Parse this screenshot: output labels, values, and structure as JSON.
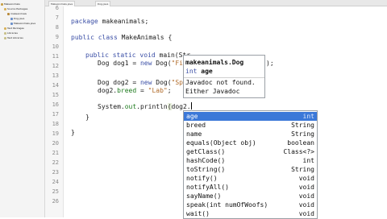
{
  "project_tree": {
    "items": [
      {
        "label": "MakeAnimals",
        "depth": 0
      },
      {
        "label": "Source Packages",
        "depth": 1
      },
      {
        "label": "makeanimals",
        "depth": 2
      },
      {
        "label": "Dog.java",
        "depth": 3
      },
      {
        "label": "MakeAnimals.java",
        "depth": 3
      },
      {
        "label": "Test Packages",
        "depth": 1
      },
      {
        "label": "Libraries",
        "depth": 1
      },
      {
        "label": "Test Libraries",
        "depth": 1
      }
    ]
  },
  "editor": {
    "tabs": [
      {
        "label": "MakeAnimals.java"
      },
      {
        "label": "Dog.java"
      }
    ],
    "line_numbers": [
      "6",
      "7",
      "8",
      "9",
      "10",
      "11",
      "12",
      "13",
      "14",
      "15",
      "16",
      "17",
      "18",
      "19",
      "20",
      "21",
      "22",
      "23",
      "24",
      "25",
      "26"
    ],
    "lines": {
      "l1": {
        "kw": "package",
        "rest": " makeanimals;"
      },
      "l2": {
        "kw1": "public",
        "kw2": "class",
        "rest": " MakeAnimals {"
      },
      "l3": {
        "kw": "public static void",
        "rest": " main(Str"
      },
      "l4": {
        "pre": "Dog dog1 = ",
        "kw": "new",
        "mid": " Dog(",
        "str": "\"Fi"
      },
      "l4_end": ");",
      "l5": {
        "pre": "Dog dog2 = ",
        "kw": "new",
        "mid": " Dog(",
        "str": "\"Sp"
      },
      "l6": {
        "pre": "dog2.",
        "fld": "breed",
        "mid": " = ",
        "str": "\"Lab\"",
        "end": ";"
      },
      "l7": {
        "pre": "System.",
        "fld": "out",
        "mid": ".println",
        "paren": "(",
        "end": "dog2."
      },
      "l8": "}",
      "l9": "}"
    }
  },
  "javadoc": {
    "title": "makeanimals.Dog",
    "signature_kw": "int",
    "signature_name": "age",
    "line1": "Javadoc not found.",
    "line2": "Either Javadoc"
  },
  "completion": {
    "items": [
      {
        "name": "age",
        "type": "int",
        "selected": true
      },
      {
        "name": "breed",
        "type": "String",
        "selected": false
      },
      {
        "name": "name",
        "type": "String",
        "selected": false
      },
      {
        "name": "equals(Object obj)",
        "type": "boolean",
        "selected": false
      },
      {
        "name": "getClass()",
        "type": "Class<?>",
        "selected": false
      },
      {
        "name": "hashCode()",
        "type": "int",
        "selected": false
      },
      {
        "name": "toString()",
        "type": "String",
        "selected": false
      },
      {
        "name": "notify()",
        "type": "void",
        "selected": false
      },
      {
        "name": "notifyAll()",
        "type": "void",
        "selected": false
      },
      {
        "name": "sayName()",
        "type": "void",
        "selected": false
      },
      {
        "name": "speak(int numOfWoofs)",
        "type": "void",
        "selected": false
      },
      {
        "name": "wait()",
        "type": "void",
        "selected": false
      }
    ]
  },
  "colors": {
    "selection": "#3b78d8",
    "keyword": "#3b4fa6",
    "string": "#b06a28",
    "field": "#1d7a1d"
  }
}
